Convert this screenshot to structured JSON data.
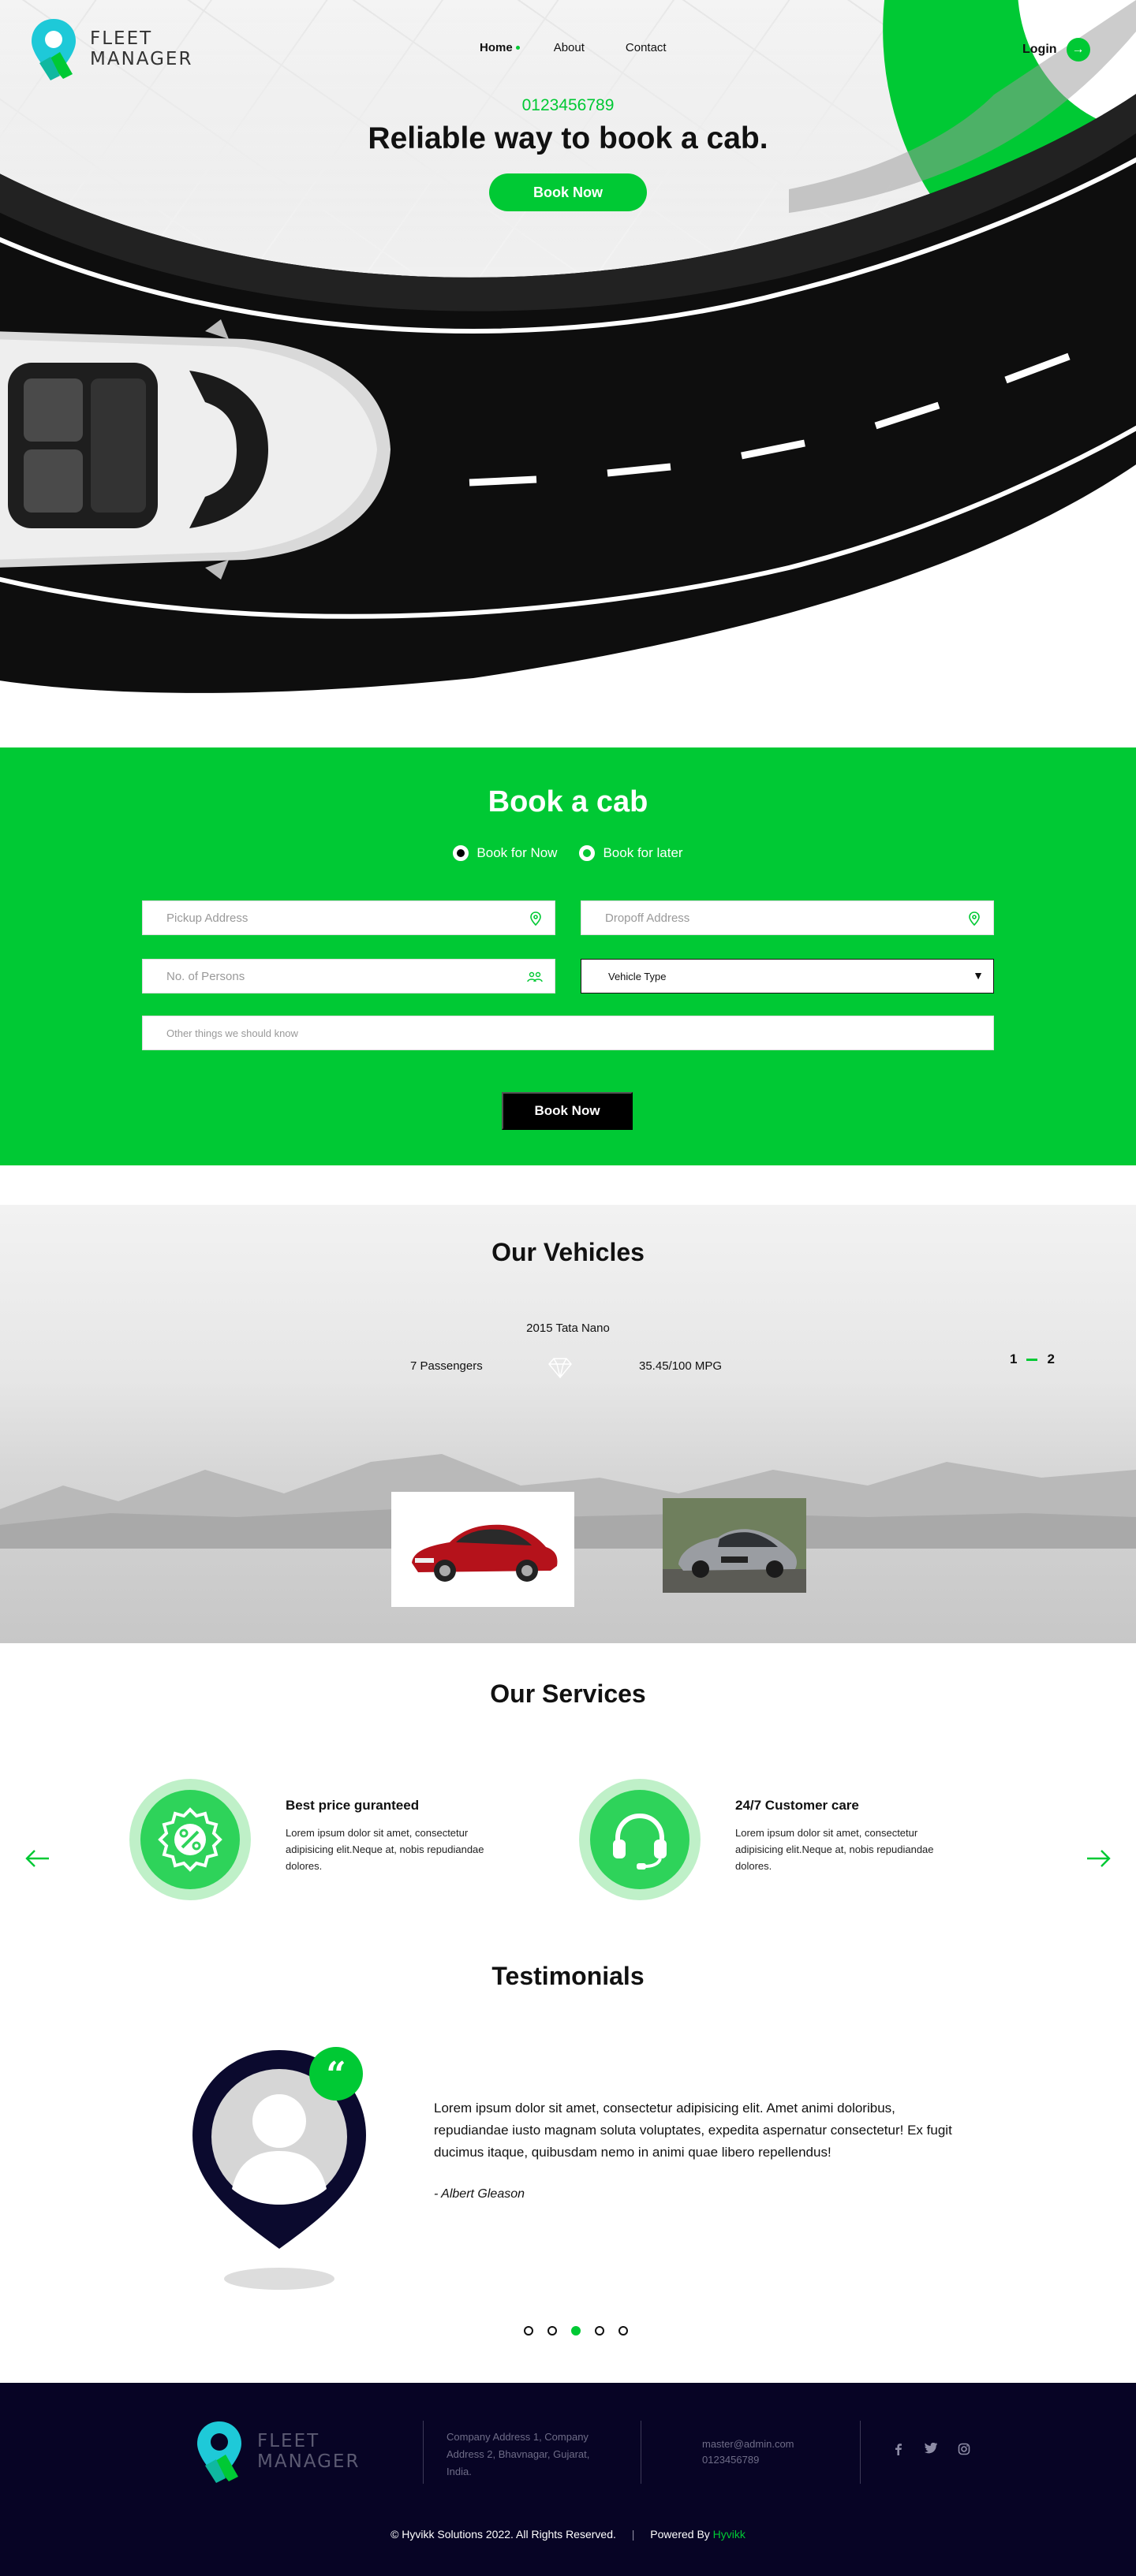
{
  "brand": {
    "line1": "FLEET",
    "line2": "MANAGER"
  },
  "nav": {
    "items": [
      {
        "label": "Home"
      },
      {
        "label": "About"
      },
      {
        "label": "Contact"
      }
    ],
    "login": "Login"
  },
  "hero": {
    "phone": "0123456789",
    "title": "Reliable way to book a cab.",
    "cta": "Book Now"
  },
  "booking": {
    "title": "Book a cab",
    "option_now": "Book for Now",
    "option_later": "Book for later",
    "pickup_placeholder": "Pickup Address",
    "dropoff_placeholder": "Dropoff Address",
    "persons_placeholder": "No. of Persons",
    "vehicle_type": "Vehicle Type",
    "notes_placeholder": "Other things we should know",
    "submit": "Book Now"
  },
  "vehicles": {
    "title": "Our Vehicles",
    "name": "2015 Tata Nano",
    "passengers": "7 Passengers",
    "mpg": "35.45/100 MPG",
    "pager": [
      "1",
      "2"
    ]
  },
  "services": {
    "title": "Our Services",
    "items": [
      {
        "title": "Best price guranteed",
        "text": "Lorem ipsum dolor sit amet, consectetur adipisicing elit.Neque at, nobis repudiandae dolores.",
        "icon": "percent-badge-icon"
      },
      {
        "title": "24/7 Customer care",
        "text": "Lorem ipsum dolor sit amet, consectetur adipisicing elit.Neque at, nobis repudiandae dolores.",
        "icon": "headset-icon"
      }
    ]
  },
  "testimonials": {
    "title": "Testimonials",
    "quote": "Lorem ipsum dolor sit amet, consectetur adipisicing elit. Amet animi doloribus, repudiandae iusto magnam soluta voluptates, expedita aspernatur consectetur! Ex fugit ducimus itaque, quibusdam nemo in animi quae libero repellendus!",
    "author": "- Albert Gleason",
    "active_dot": 3
  },
  "footer": {
    "address": "Company Address 1, Company Address 2, Bhavnagar, Gujarat, India.",
    "email": "master@admin.com",
    "phone": "0123456789",
    "copyright": "© Hyvikk Solutions 2022. All Rights Reserved.",
    "powered_label": "Powered By",
    "powered_brand": "Hyvikk"
  },
  "colors": {
    "accent": "#00c934",
    "footer_bg": "#070425",
    "pin": "#0b0a2e"
  }
}
